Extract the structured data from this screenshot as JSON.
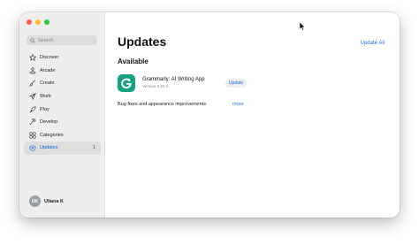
{
  "window": {
    "traffic_lights": [
      "#ff5f57",
      "#febc2e",
      "#28c840"
    ]
  },
  "sidebar": {
    "search": {
      "placeholder": "Search",
      "icon": "search-icon"
    },
    "items": [
      {
        "label": "Discover",
        "icon": "star-icon"
      },
      {
        "label": "Arcade",
        "icon": "joystick-icon"
      },
      {
        "label": "Create",
        "icon": "brush-icon"
      },
      {
        "label": "Work",
        "icon": "paper-plane-icon"
      },
      {
        "label": "Play",
        "icon": "rocket-icon"
      },
      {
        "label": "Develop",
        "icon": "hammer-icon"
      },
      {
        "label": "Categories",
        "icon": "grid-icon"
      },
      {
        "label": "Updates",
        "icon": "download-icon",
        "count": "1",
        "active": true
      }
    ],
    "user": {
      "initials": "UK",
      "name": "Uliana K"
    }
  },
  "main": {
    "title": "Updates",
    "update_all_label": "Update All",
    "section_title": "Available",
    "app": {
      "name": "Grammarly: AI Writing App",
      "version": "Version 9.68.0",
      "update_label": "Update",
      "notes": "Bug fixes and appearance improvements.",
      "more_label": "more"
    }
  },
  "colors": {
    "accent": "#1a6fdc",
    "grammarly_green": "#15a37f",
    "sidebar_bg": "#eeeeee"
  }
}
